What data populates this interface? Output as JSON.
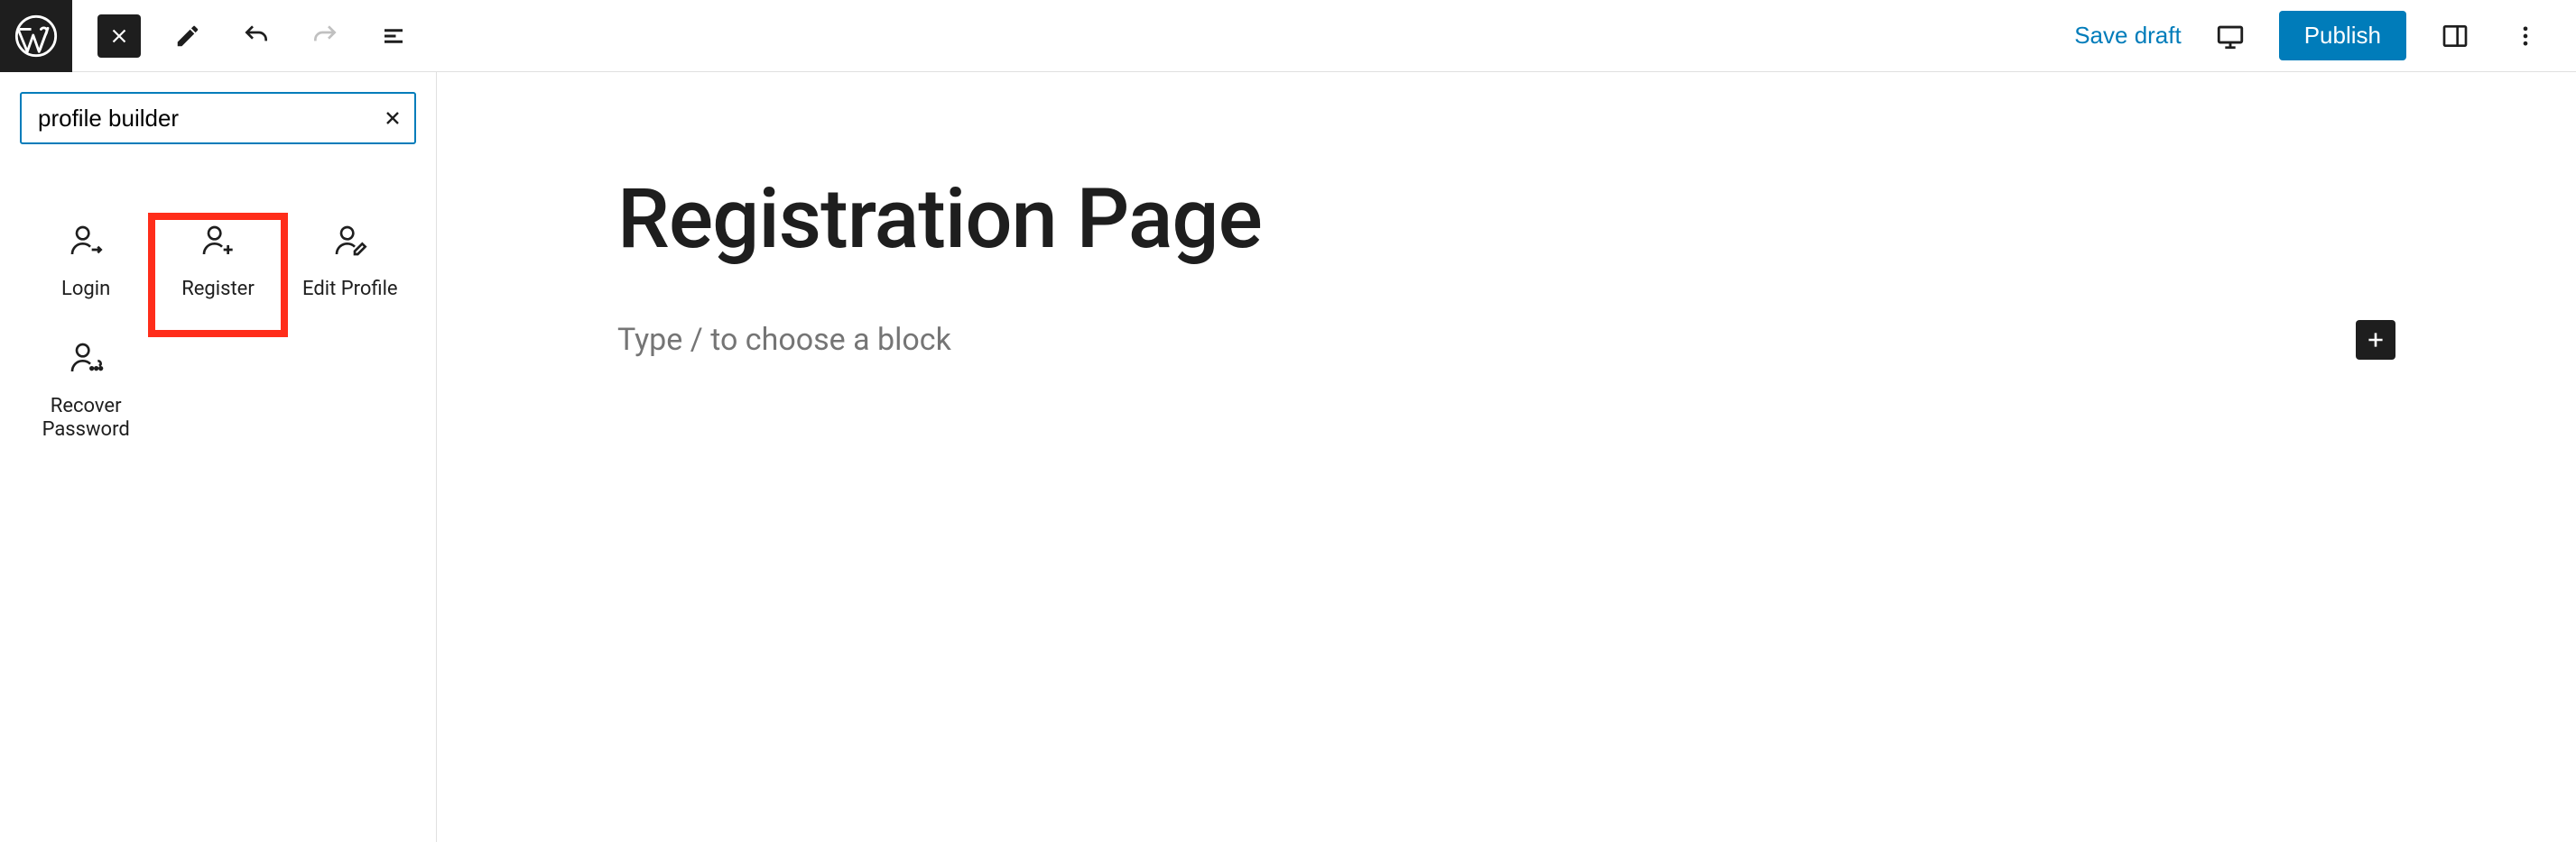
{
  "toolbar": {
    "save_draft": "Save draft",
    "publish": "Publish"
  },
  "inserter": {
    "search_value": "profile builder",
    "blocks": [
      {
        "label": "Login"
      },
      {
        "label": "Register",
        "highlighted": true
      },
      {
        "label": "Edit Profile"
      },
      {
        "label": "Recover Password"
      }
    ]
  },
  "editor": {
    "title": "Registration Page",
    "placeholder": "Type / to choose a block"
  }
}
